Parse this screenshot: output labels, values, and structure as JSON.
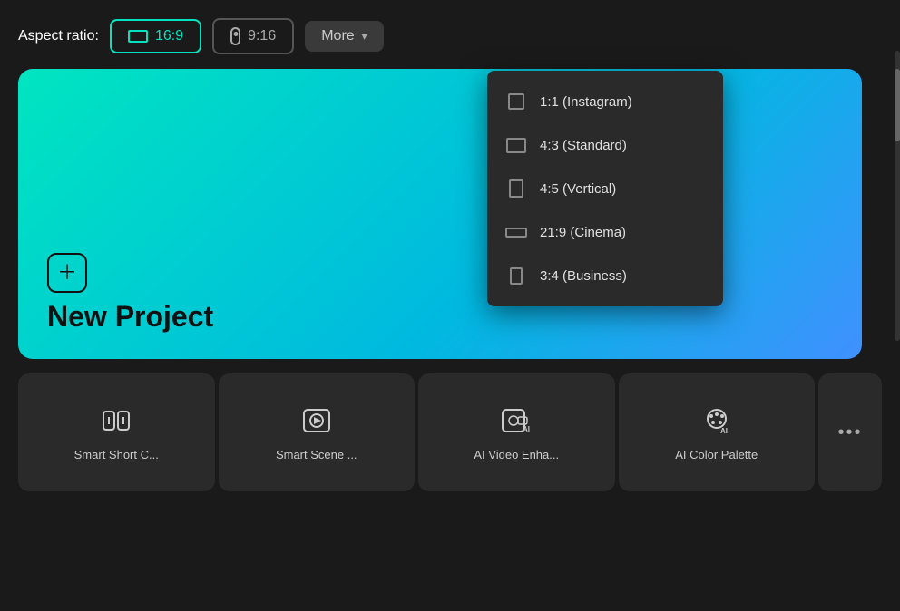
{
  "header": {
    "aspect_ratio_label": "Aspect ratio:",
    "btn_169_label": "16:9",
    "btn_916_label": "9:16",
    "btn_more_label": "More"
  },
  "dropdown": {
    "items": [
      {
        "id": "1_1",
        "label": "1:1 (Instagram)",
        "icon_type": "square"
      },
      {
        "id": "4_3",
        "label": "4:3 (Standard)",
        "icon_type": "43"
      },
      {
        "id": "4_5",
        "label": "4:5 (Vertical)",
        "icon_type": "45"
      },
      {
        "id": "21_9",
        "label": "21:9 (Cinema)",
        "icon_type": "219"
      },
      {
        "id": "3_4",
        "label": "3:4 (Business)",
        "icon_type": "34"
      }
    ]
  },
  "new_project": {
    "title": "New Project"
  },
  "tools": [
    {
      "id": "smart_short",
      "label": "Smart Short C...",
      "icon": "smart-short"
    },
    {
      "id": "smart_scene",
      "label": "Smart Scene ...",
      "icon": "smart-scene"
    },
    {
      "id": "ai_video",
      "label": "AI Video Enha...",
      "icon": "ai-video"
    },
    {
      "id": "ai_color",
      "label": "AI Color Palette",
      "icon": "ai-color"
    }
  ],
  "more_tools_label": "...",
  "colors": {
    "active_border": "#00e5c0",
    "active_text": "#00e5c0",
    "bg_card": "#2a2a2a",
    "bg_more_btn": "#3a3a3a"
  }
}
